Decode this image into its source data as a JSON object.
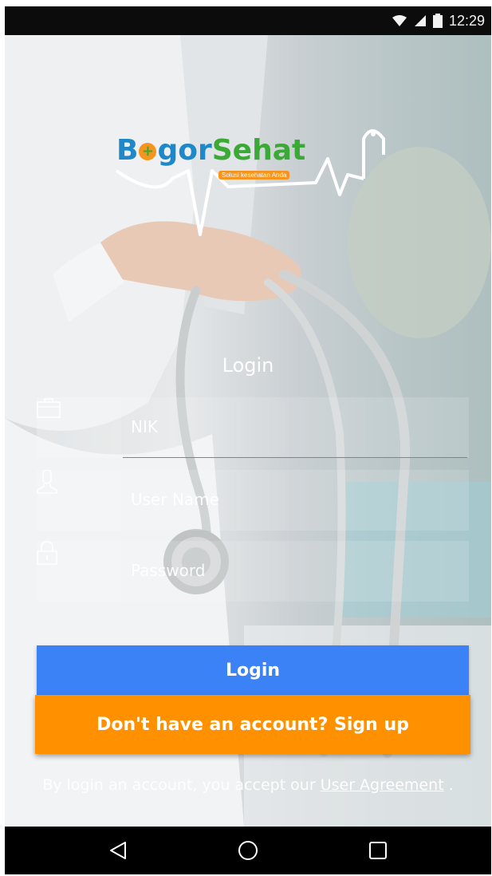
{
  "status_bar": {
    "time": "12:29",
    "icons": [
      "wifi-icon",
      "signal-icon",
      "battery-icon"
    ]
  },
  "logo": {
    "part1": "B",
    "part2": "gor",
    "part3": "Sehat",
    "tagline": "Solusi kesehatan Anda"
  },
  "form": {
    "title": "Login",
    "nik": {
      "placeholder": "NIK",
      "icon": "briefcase-icon"
    },
    "username": {
      "placeholder": "User Name",
      "icon": "user-icon"
    },
    "password": {
      "placeholder": "Password",
      "icon": "lock-icon"
    }
  },
  "buttons": {
    "login": "Login",
    "signup": "Don't have an account? Sign up"
  },
  "agreement": {
    "prefix": "By login an account, you accept our ",
    "link": "User Agreement",
    "suffix": " ."
  },
  "nav": {
    "icons": [
      "back-icon",
      "home-icon",
      "recents-icon"
    ]
  },
  "colors": {
    "login_button": "#3b82f6",
    "signup_button": "#ff9100",
    "logo_blue": "#1e88c8",
    "logo_green": "#3aa935",
    "tagline_orange": "#f7941d"
  }
}
